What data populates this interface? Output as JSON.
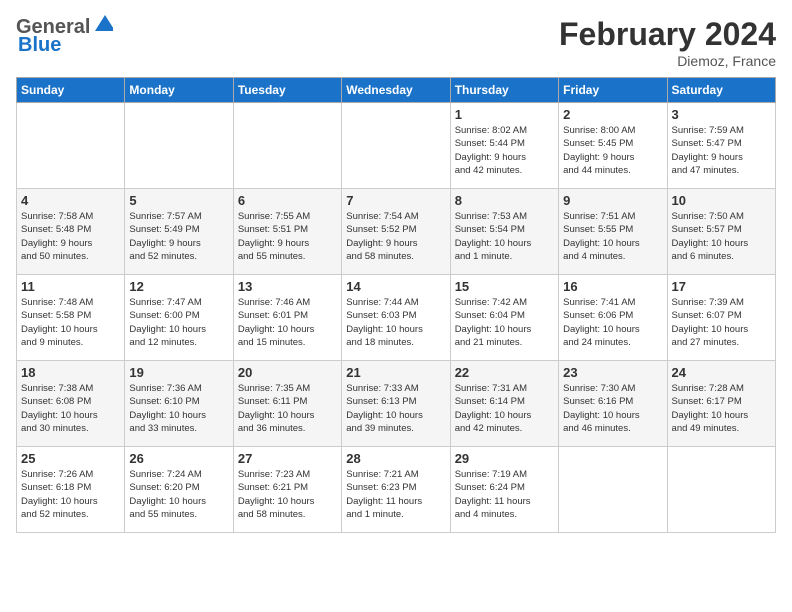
{
  "header": {
    "logo_line1": "General",
    "logo_line2": "Blue",
    "title": "February 2024",
    "subtitle": "Diemoz, France"
  },
  "days_of_week": [
    "Sunday",
    "Monday",
    "Tuesday",
    "Wednesday",
    "Thursday",
    "Friday",
    "Saturday"
  ],
  "weeks": [
    [
      {
        "day": "",
        "info": ""
      },
      {
        "day": "",
        "info": ""
      },
      {
        "day": "",
        "info": ""
      },
      {
        "day": "",
        "info": ""
      },
      {
        "day": "1",
        "info": "Sunrise: 8:02 AM\nSunset: 5:44 PM\nDaylight: 9 hours\nand 42 minutes."
      },
      {
        "day": "2",
        "info": "Sunrise: 8:00 AM\nSunset: 5:45 PM\nDaylight: 9 hours\nand 44 minutes."
      },
      {
        "day": "3",
        "info": "Sunrise: 7:59 AM\nSunset: 5:47 PM\nDaylight: 9 hours\nand 47 minutes."
      }
    ],
    [
      {
        "day": "4",
        "info": "Sunrise: 7:58 AM\nSunset: 5:48 PM\nDaylight: 9 hours\nand 50 minutes."
      },
      {
        "day": "5",
        "info": "Sunrise: 7:57 AM\nSunset: 5:49 PM\nDaylight: 9 hours\nand 52 minutes."
      },
      {
        "day": "6",
        "info": "Sunrise: 7:55 AM\nSunset: 5:51 PM\nDaylight: 9 hours\nand 55 minutes."
      },
      {
        "day": "7",
        "info": "Sunrise: 7:54 AM\nSunset: 5:52 PM\nDaylight: 9 hours\nand 58 minutes."
      },
      {
        "day": "8",
        "info": "Sunrise: 7:53 AM\nSunset: 5:54 PM\nDaylight: 10 hours\nand 1 minute."
      },
      {
        "day": "9",
        "info": "Sunrise: 7:51 AM\nSunset: 5:55 PM\nDaylight: 10 hours\nand 4 minutes."
      },
      {
        "day": "10",
        "info": "Sunrise: 7:50 AM\nSunset: 5:57 PM\nDaylight: 10 hours\nand 6 minutes."
      }
    ],
    [
      {
        "day": "11",
        "info": "Sunrise: 7:48 AM\nSunset: 5:58 PM\nDaylight: 10 hours\nand 9 minutes."
      },
      {
        "day": "12",
        "info": "Sunrise: 7:47 AM\nSunset: 6:00 PM\nDaylight: 10 hours\nand 12 minutes."
      },
      {
        "day": "13",
        "info": "Sunrise: 7:46 AM\nSunset: 6:01 PM\nDaylight: 10 hours\nand 15 minutes."
      },
      {
        "day": "14",
        "info": "Sunrise: 7:44 AM\nSunset: 6:03 PM\nDaylight: 10 hours\nand 18 minutes."
      },
      {
        "day": "15",
        "info": "Sunrise: 7:42 AM\nSunset: 6:04 PM\nDaylight: 10 hours\nand 21 minutes."
      },
      {
        "day": "16",
        "info": "Sunrise: 7:41 AM\nSunset: 6:06 PM\nDaylight: 10 hours\nand 24 minutes."
      },
      {
        "day": "17",
        "info": "Sunrise: 7:39 AM\nSunset: 6:07 PM\nDaylight: 10 hours\nand 27 minutes."
      }
    ],
    [
      {
        "day": "18",
        "info": "Sunrise: 7:38 AM\nSunset: 6:08 PM\nDaylight: 10 hours\nand 30 minutes."
      },
      {
        "day": "19",
        "info": "Sunrise: 7:36 AM\nSunset: 6:10 PM\nDaylight: 10 hours\nand 33 minutes."
      },
      {
        "day": "20",
        "info": "Sunrise: 7:35 AM\nSunset: 6:11 PM\nDaylight: 10 hours\nand 36 minutes."
      },
      {
        "day": "21",
        "info": "Sunrise: 7:33 AM\nSunset: 6:13 PM\nDaylight: 10 hours\nand 39 minutes."
      },
      {
        "day": "22",
        "info": "Sunrise: 7:31 AM\nSunset: 6:14 PM\nDaylight: 10 hours\nand 42 minutes."
      },
      {
        "day": "23",
        "info": "Sunrise: 7:30 AM\nSunset: 6:16 PM\nDaylight: 10 hours\nand 46 minutes."
      },
      {
        "day": "24",
        "info": "Sunrise: 7:28 AM\nSunset: 6:17 PM\nDaylight: 10 hours\nand 49 minutes."
      }
    ],
    [
      {
        "day": "25",
        "info": "Sunrise: 7:26 AM\nSunset: 6:18 PM\nDaylight: 10 hours\nand 52 minutes."
      },
      {
        "day": "26",
        "info": "Sunrise: 7:24 AM\nSunset: 6:20 PM\nDaylight: 10 hours\nand 55 minutes."
      },
      {
        "day": "27",
        "info": "Sunrise: 7:23 AM\nSunset: 6:21 PM\nDaylight: 10 hours\nand 58 minutes."
      },
      {
        "day": "28",
        "info": "Sunrise: 7:21 AM\nSunset: 6:23 PM\nDaylight: 11 hours\nand 1 minute."
      },
      {
        "day": "29",
        "info": "Sunrise: 7:19 AM\nSunset: 6:24 PM\nDaylight: 11 hours\nand 4 minutes."
      },
      {
        "day": "",
        "info": ""
      },
      {
        "day": "",
        "info": ""
      }
    ]
  ]
}
